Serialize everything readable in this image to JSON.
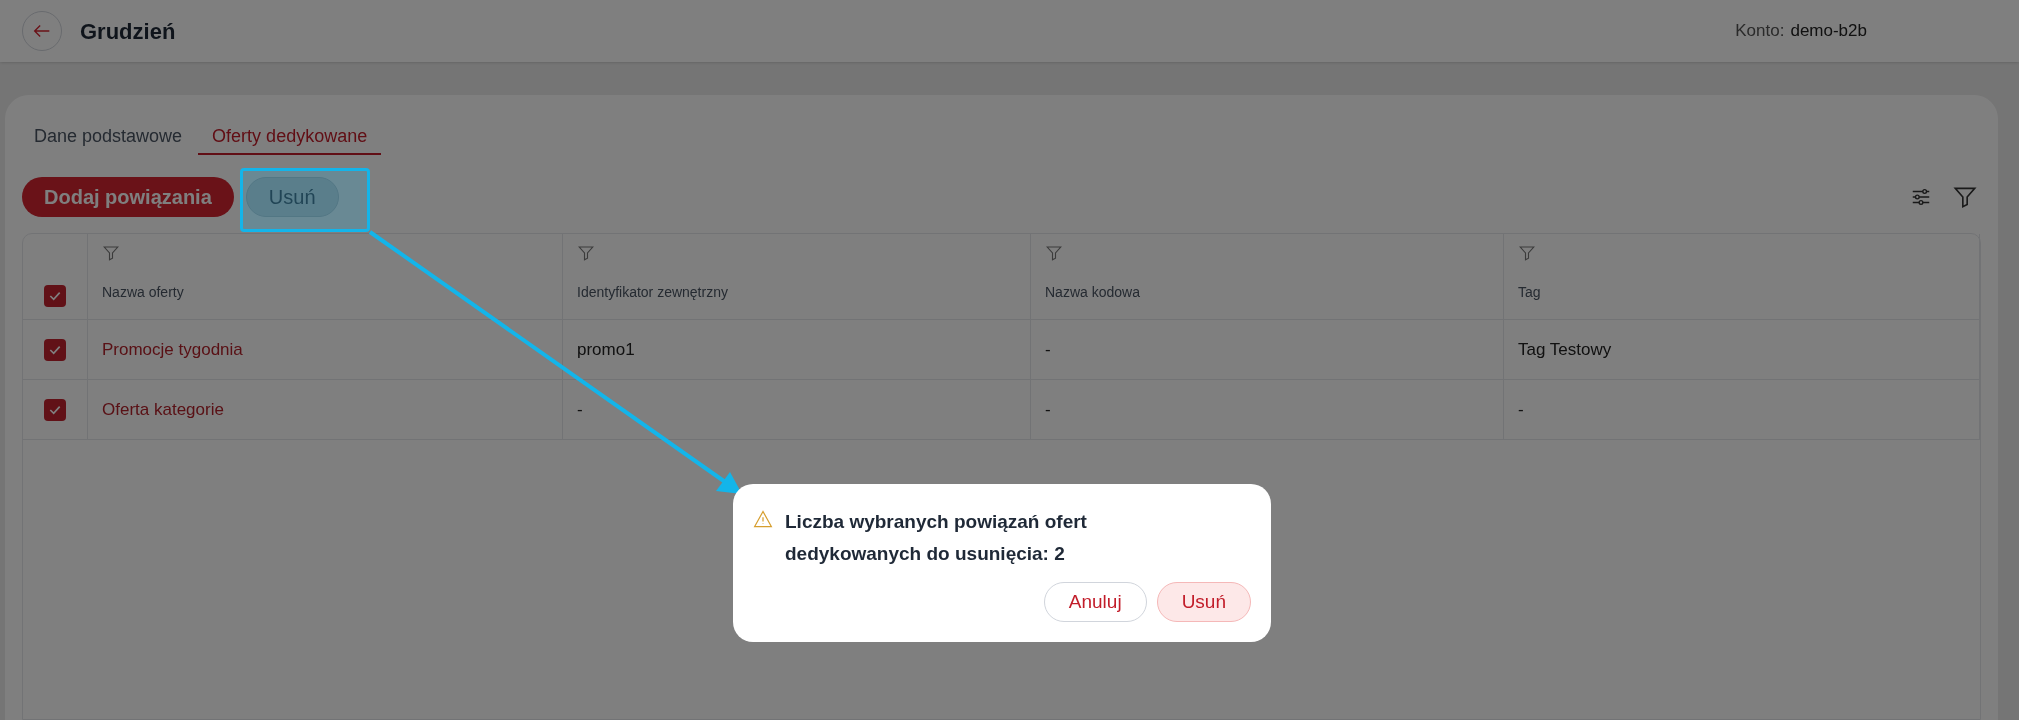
{
  "header": {
    "title": "Grudzień",
    "account_label": "Konto:",
    "account": "demo-b2b"
  },
  "tabs": [
    {
      "label": "Dane podstawowe",
      "selected": false
    },
    {
      "label": "Oferty dedykowane",
      "selected": true
    }
  ],
  "toolbar": {
    "buttons": [
      {
        "label": "Dodaj powiązania",
        "kind": "primary"
      },
      {
        "label": "Usuń",
        "kind": "secondary"
      }
    ]
  },
  "table": {
    "select_all_checked": true,
    "columns": [
      "Nazwa oferty",
      "Identyfikator zewnętrzny",
      "Nazwa kodowa",
      "Tag"
    ],
    "rows": [
      {
        "checked": true,
        "cells": [
          "Promocje tygodnia",
          "promo1",
          "-",
          "Tag Testowy"
        ]
      },
      {
        "checked": true,
        "cells": [
          "Oferta kategorie",
          "-",
          "-",
          "-"
        ]
      }
    ]
  },
  "dialog": {
    "message": "Liczba wybranych powiązań ofert dedykowanych do usunięcia: 2",
    "buttons": [
      {
        "label": "Anuluj",
        "kind": "outline"
      },
      {
        "label": "Usuń",
        "kind": "danger"
      }
    ]
  }
}
